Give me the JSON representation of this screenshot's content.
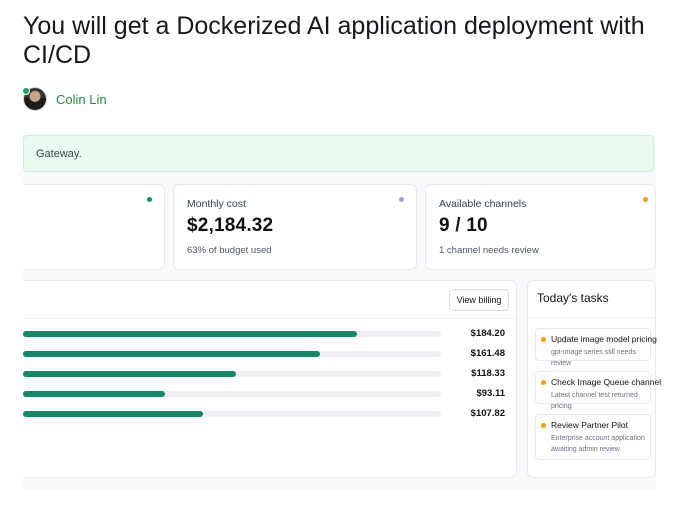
{
  "title": "You will get a Dockerized AI application deployment with CI/CD",
  "seller": {
    "name": "Colin Lin"
  },
  "banner": {
    "text": "Gateway."
  },
  "stats": [
    {
      "label": "",
      "value": "",
      "sub": "",
      "dot_color": "#0e8a6a"
    },
    {
      "label": "Monthly cost",
      "value": "$2,184.32",
      "sub": "63% of budget used",
      "dot_color": "#9ca3c8"
    },
    {
      "label": "Available channels",
      "value": "9 / 10",
      "sub": "1 channel needs review",
      "dot_color": "#f59e0b"
    }
  ],
  "billing": {
    "button_label": "View billing",
    "bar_color": "#0e8a6a",
    "rows": [
      {
        "amount": "$184.20",
        "fraction": 0.8
      },
      {
        "amount": "$161.48",
        "fraction": 0.71
      },
      {
        "amount": "$118.33",
        "fraction": 0.51
      },
      {
        "amount": "$93.11",
        "fraction": 0.34
      },
      {
        "amount": "$107.82",
        "fraction": 0.43
      }
    ]
  },
  "tasks": {
    "title": "Today's tasks",
    "items": [
      {
        "title": "Update image model pricing",
        "desc": "gpt-image series still needs review"
      },
      {
        "title": "Check Image Queue channel",
        "desc": "Latest channel test returned pricing"
      },
      {
        "title": "Review Partner Pilot",
        "desc": "Enterprise account application awaiting admin review"
      }
    ]
  }
}
